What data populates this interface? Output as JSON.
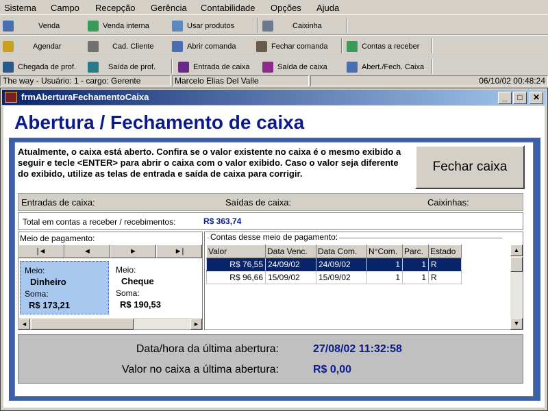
{
  "menu": [
    "Sistema",
    "Campo",
    "Recepção",
    "Gerência",
    "Contabilidade",
    "Opções",
    "Ajuda"
  ],
  "toolbar": {
    "row1": [
      {
        "label": "Venda",
        "icon": "sale-icon",
        "color": "#4a6fb0"
      },
      {
        "label": "Venda interna",
        "icon": "internal-sale-icon",
        "color": "#3a9a5a"
      },
      {
        "label": "Usar produtos",
        "icon": "products-icon",
        "color": "#5a8ac0"
      },
      {
        "label": "Caixinha",
        "icon": "tip-box-icon",
        "color": "#6a7a90"
      }
    ],
    "row2": [
      {
        "label": "Agendar",
        "icon": "schedule-icon",
        "color": "#c9a020"
      },
      {
        "label": "Cad. Cliente",
        "icon": "client-register-icon",
        "color": "#707070"
      },
      {
        "label": "Abrir comanda",
        "icon": "open-order-icon",
        "color": "#4a6fb0"
      },
      {
        "label": "Fechar comanda",
        "icon": "close-order-icon",
        "color": "#6a5a4a"
      },
      {
        "label": "Contas a receber",
        "icon": "receivables-icon",
        "color": "#3a9a5a"
      }
    ],
    "row3": [
      {
        "label": "Chegada de prof.",
        "icon": "arrival-icon",
        "color": "#2a5a8a"
      },
      {
        "label": "Saída de prof.",
        "icon": "departure-icon",
        "color": "#2a7a8a"
      },
      {
        "label": "Entrada de caixa",
        "icon": "cash-in-icon",
        "color": "#6a2a8a"
      },
      {
        "label": "Saída de caixa",
        "icon": "cash-out-icon",
        "color": "#8a2a8a"
      },
      {
        "label": "Abert./Fech. Caixa",
        "icon": "cash-register-icon",
        "color": "#4a6fb0"
      }
    ]
  },
  "status": {
    "company": "The way - Usuário: 1 - cargo: Gerente",
    "user": "Marcelo Elias Del Valle",
    "datetime": "06/10/02 00:48:24"
  },
  "window": {
    "title": "frmAberturaFechamentoCaixa",
    "min": "_",
    "max": "□",
    "close": "✕"
  },
  "form": {
    "heading": "Abertura / Fechamento de caixa",
    "intro": "Atualmente, o caixa está aberto. Confira se o valor existente no caixa é o mesmo exibido a seguir e tecle <ENTER> para abrir o caixa com o valor exibido. Caso o valor seja diferente do exibido, utilize as telas de entrada e saída  de caixa para corrigir.",
    "close_button": "Fechar caixa",
    "entradas": "Entradas de caixa:",
    "saidas": "Saídas de caixa:",
    "caixinhas": "Caixinhas:",
    "total_label": "Total em contas a receber / recebimentos:",
    "total_value": "R$ 363,74",
    "meio_caption": "Meio de pagamento:",
    "nav": [
      "|◄",
      "◄",
      "►",
      "►|"
    ],
    "cards": [
      {
        "meio_label": "Meio:",
        "meio": "Dinheiro",
        "soma_label": "Soma:",
        "soma": "R$ 173,21"
      },
      {
        "meio_label": "Meio:",
        "meio": "Cheque",
        "soma_label": "Soma:",
        "soma": "R$ 190,53"
      }
    ],
    "contas_caption": "Contas desse meio de pagamento:",
    "grid_headers": [
      "Valor",
      "Data Venc.",
      "Data Com.",
      "N°Com.",
      "Parc.",
      "Estado"
    ],
    "grid_rows": [
      [
        "R$ 76,55",
        "24/09/02",
        "24/09/02",
        "1",
        "1",
        "R"
      ],
      [
        "R$ 96,66",
        "15/09/02",
        "15/09/02",
        "1",
        "1",
        "R"
      ]
    ],
    "last_open_label": "Data/hora da última abertura:",
    "last_open_value": "27/08/02 11:32:58",
    "cash_label": "Valor no caixa a última abertura:",
    "cash_value": "R$ 0,00"
  }
}
